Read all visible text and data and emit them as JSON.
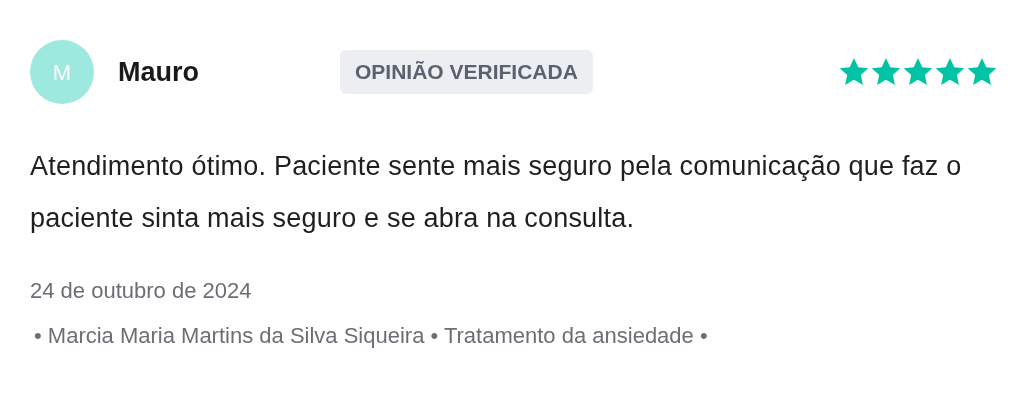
{
  "review": {
    "avatar_initial": "M",
    "author": "Mauro",
    "badge": "OPINIÃO VERIFICADA",
    "stars": 5,
    "text": "Atendimento ótimo. Paciente sente mais seguro pela comunicação que faz o paciente sinta mais seguro e se abra na consulta.",
    "date": "24 de outubro de 2024",
    "details": "• Marcia Maria Martins da Silva Siqueira • Tratamento da ansiedade •"
  }
}
